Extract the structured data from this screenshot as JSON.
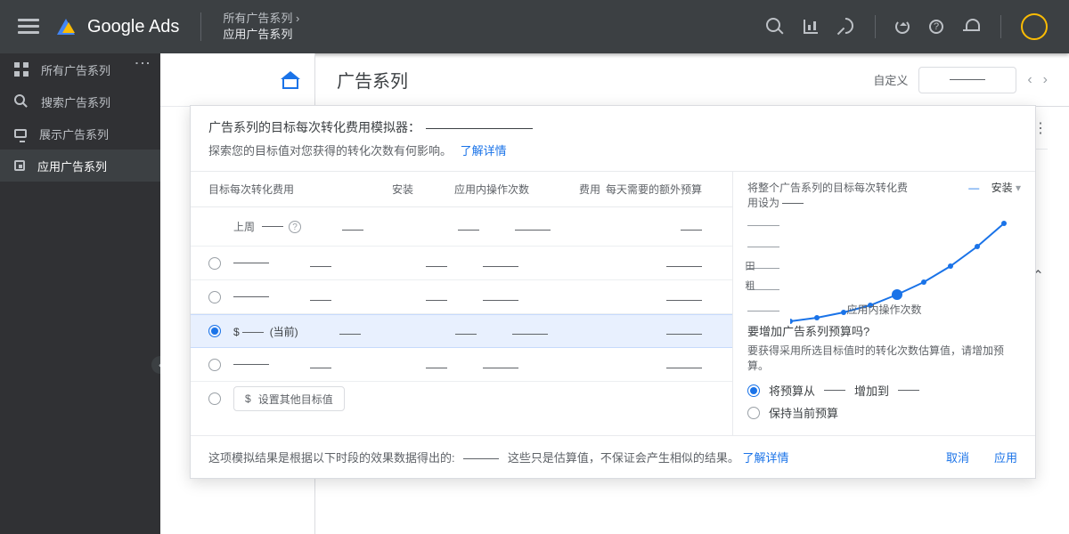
{
  "topbar": {
    "logo_text": "Google Ads",
    "crumb_top": "所有广告系列  ›",
    "crumb_sub": "应用广告系列"
  },
  "sidebar": {
    "items": [
      {
        "label": "所有广告系列"
      },
      {
        "label": "搜索广告系列"
      },
      {
        "label": "展示广告系列"
      },
      {
        "label": "应用广告系列"
      }
    ]
  },
  "content": {
    "title": "广告系列",
    "custom_label": "自定义"
  },
  "panel": {
    "title": "广告系列的目标每次转化费用模拟器：",
    "subtitle": "探索您的目标值对您获得的转化次数有何影响。",
    "learn_more": "了解详情",
    "columns": {
      "target": "目标每次转化费用",
      "install": "安装",
      "inapp": "应用内操作次数",
      "cost": "费用",
      "budget": "每天需要的额外预算"
    },
    "lastweek_label": "上周",
    "current_suffix": "(当前)",
    "other_target_label": "设置其他目标值",
    "chart": {
      "title_prefix": "将整个广告系列的目标每次转化费用设为",
      "dropdown": "安装",
      "ylabel": "田 粗",
      "xlabel": "应用内操作次数"
    },
    "budget_block": {
      "question": "要增加广告系列预算吗?",
      "hint": "要获得采用所选目标值时的转化次数估算值，请增加预算。",
      "opt_increase_a": "将预算从",
      "opt_increase_b": "增加到",
      "opt_keep": "保持当前预算"
    },
    "footer": {
      "text_a": "这项模拟结果是根据以下时段的效果数据得出的:",
      "text_b": "这些只是估算值，不保证会产生相似的结果。",
      "learn_more": "了解详情",
      "cancel": "取消",
      "apply": "应用"
    }
  },
  "chart_data": {
    "type": "line",
    "title": "将整个广告系列的目标每次转化费用设为 —",
    "xlabel": "应用内操作次数",
    "ylabel": "安装",
    "series": [
      {
        "name": "安装",
        "x": [
          0,
          1,
          2,
          3,
          4,
          5,
          6,
          7,
          8
        ],
        "y": [
          10,
          12,
          15,
          20,
          28,
          40,
          55,
          78,
          110
        ]
      }
    ],
    "selected_index": 4,
    "xlim": [
      0,
      8
    ],
    "ylim": [
      0,
      120
    ]
  }
}
